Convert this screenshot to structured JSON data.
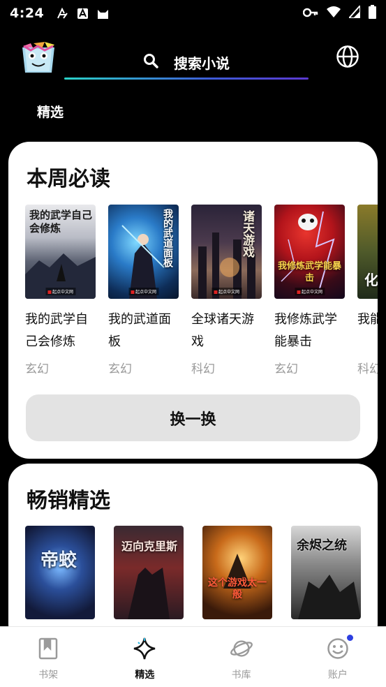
{
  "status_bar": {
    "time": "4:24",
    "left_icons": [
      "font-icon",
      "text-a-icon",
      "cat-icon"
    ],
    "right_icons": [
      "key-icon",
      "wifi-icon",
      "signal-icon",
      "battery-icon"
    ]
  },
  "header": {
    "search_label": "搜索小说",
    "accent_gradient": [
      "#2ad3c8",
      "#3e5bd8",
      "#5b39d0"
    ]
  },
  "section_tab": "精选",
  "weekly": {
    "title": "本周必读",
    "books": [
      {
        "title": "我的武学自己会修炼",
        "genre": "玄幻",
        "cover_text": "我的武学自己会修炼"
      },
      {
        "title": "我的武道面板",
        "genre": "玄幻",
        "cover_text": "我的武道面板"
      },
      {
        "title": "全球诸天游戏",
        "genre": "科幻",
        "cover_text": "诸天游戏"
      },
      {
        "title": "我修炼武学能暴击",
        "genre": "玄幻",
        "cover_text": "我修炼武学能暴击"
      },
      {
        "title": "我能万物",
        "genre": "科幻",
        "cover_text": "化"
      }
    ],
    "swap_label": "换一换"
  },
  "bestseller": {
    "title": "畅销精选",
    "covers": [
      "帝蛟",
      "迈向克里斯",
      "这个游戏太一般",
      "余烬之统"
    ]
  },
  "bottom_nav": {
    "items": [
      {
        "label": "书架",
        "icon": "bookmark-icon",
        "active": false
      },
      {
        "label": "精选",
        "icon": "sparkle-icon",
        "active": true
      },
      {
        "label": "书库",
        "icon": "planet-icon",
        "active": false
      },
      {
        "label": "账户",
        "icon": "smiley-icon",
        "active": false,
        "badge": true
      }
    ]
  }
}
